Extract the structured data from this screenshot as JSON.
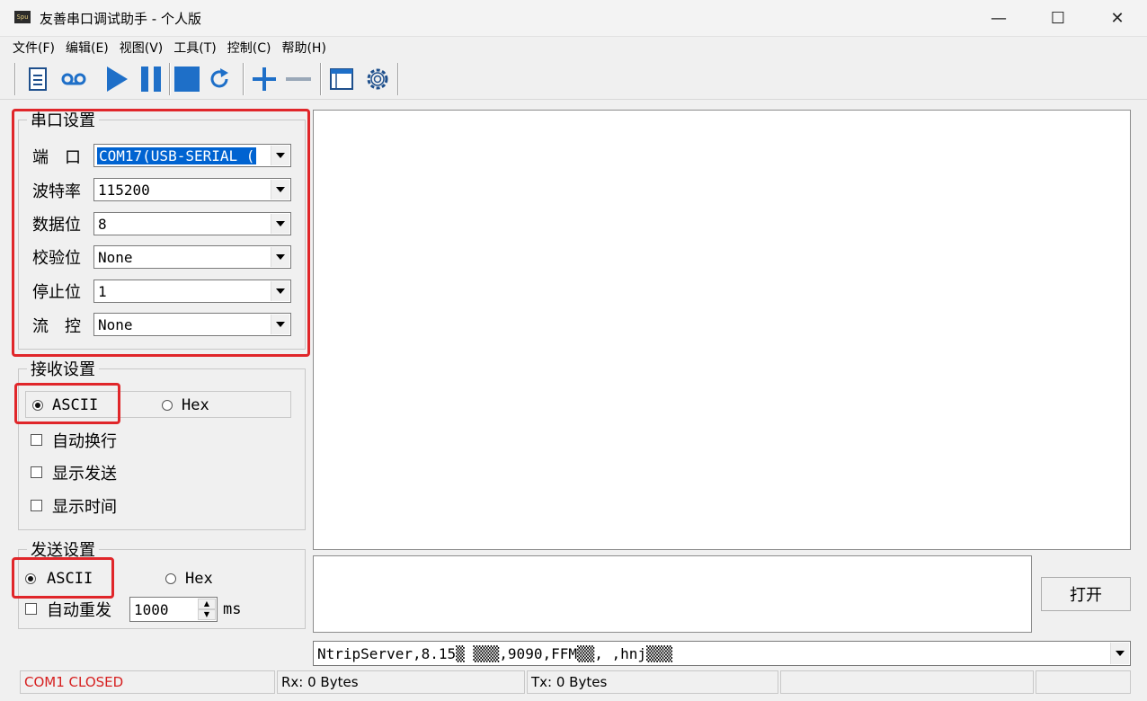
{
  "window": {
    "title": "友善串口调试助手 - 个人版",
    "icon_text": "Spu",
    "minimize": "—",
    "maximize": "☐",
    "close": "✕"
  },
  "menu": [
    "文件(F)",
    "编辑(E)",
    "视图(V)",
    "工具(T)",
    "控制(C)",
    "帮助(H)"
  ],
  "toolbar": {
    "icons": [
      "new-file-icon",
      "record-icon",
      "play-icon",
      "pause-icon",
      "stop-icon",
      "refresh-icon",
      "plus-icon",
      "minus-icon",
      "window-icon",
      "settings-gear-icon"
    ],
    "colors": {
      "accent": "#1e6fc8"
    }
  },
  "serial": {
    "legend": "串口设置",
    "rows": [
      {
        "label": "端　口",
        "value": "COM17(USB-SERIAL ("
      },
      {
        "label": "波特率",
        "value": "115200"
      },
      {
        "label": "数据位",
        "value": "8"
      },
      {
        "label": "校验位",
        "value": "None"
      },
      {
        "label": "停止位",
        "value": "1"
      },
      {
        "label": "流　控",
        "value": "None"
      }
    ]
  },
  "receive": {
    "legend": "接收设置",
    "ascii": "ASCII",
    "hex": "Hex",
    "auto_wrap": "自动换行",
    "show_send": "显示发送",
    "show_time": "显示时间"
  },
  "send": {
    "legend": "发送设置",
    "ascii": "ASCII",
    "hex": "Hex",
    "auto_resend": "自动重发",
    "interval": "1000",
    "unit": "ms"
  },
  "open_button": "打开",
  "command_input": "NtripServer,8.15▒ ▒▒▒,9090,FFM▒▒, ,hnj▒▒▒",
  "statusbar": {
    "port": "COM1 CLOSED",
    "rx": "Rx: 0 Bytes",
    "tx": "Tx: 0 Bytes",
    "port_color": "#d62020"
  }
}
